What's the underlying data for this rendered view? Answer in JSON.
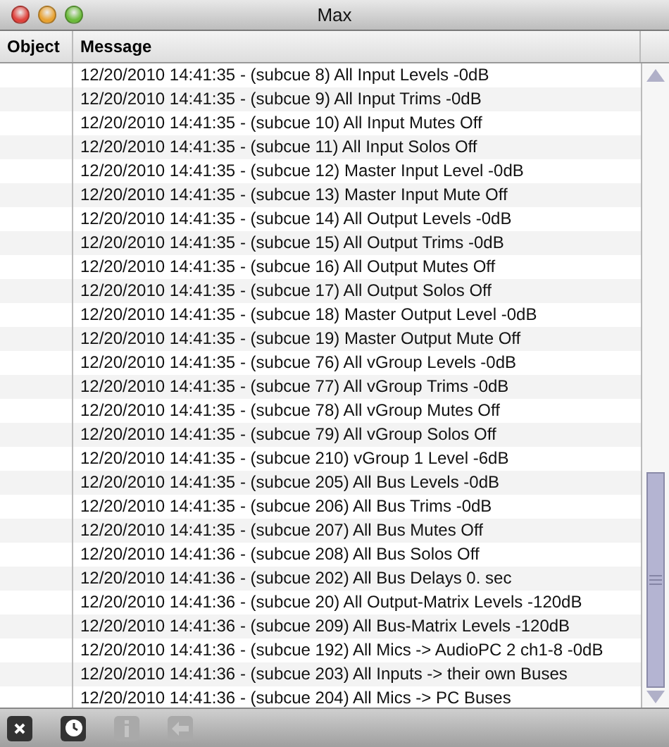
{
  "window": {
    "title": "Max"
  },
  "table": {
    "columns": [
      "Object",
      "Message"
    ],
    "rows": [
      {
        "object": "",
        "message": "12/20/2010 14:41:35 - (subcue 8) All Input Levels -0dB"
      },
      {
        "object": "",
        "message": "12/20/2010 14:41:35 - (subcue 9) All Input Trims -0dB"
      },
      {
        "object": "",
        "message": "12/20/2010 14:41:35 - (subcue 10) All Input Mutes Off"
      },
      {
        "object": "",
        "message": "12/20/2010 14:41:35 - (subcue 11) All Input Solos Off"
      },
      {
        "object": "",
        "message": "12/20/2010 14:41:35 - (subcue 12) Master Input Level -0dB"
      },
      {
        "object": "",
        "message": "12/20/2010 14:41:35 - (subcue 13) Master Input Mute Off"
      },
      {
        "object": "",
        "message": "12/20/2010 14:41:35 - (subcue 14) All Output Levels -0dB"
      },
      {
        "object": "",
        "message": "12/20/2010 14:41:35 - (subcue 15) All Output Trims -0dB"
      },
      {
        "object": "",
        "message": "12/20/2010 14:41:35 - (subcue 16) All Output Mutes Off"
      },
      {
        "object": "",
        "message": "12/20/2010 14:41:35 - (subcue 17) All Output Solos Off"
      },
      {
        "object": "",
        "message": "12/20/2010 14:41:35 - (subcue 18) Master Output Level -0dB"
      },
      {
        "object": "",
        "message": "12/20/2010 14:41:35 - (subcue 19) Master Output Mute Off"
      },
      {
        "object": "",
        "message": "12/20/2010 14:41:35 - (subcue 76) All vGroup Levels -0dB"
      },
      {
        "object": "",
        "message": "12/20/2010 14:41:35 - (subcue 77) All vGroup Trims -0dB"
      },
      {
        "object": "",
        "message": "12/20/2010 14:41:35 - (subcue 78) All vGroup Mutes Off"
      },
      {
        "object": "",
        "message": "12/20/2010 14:41:35 - (subcue 79) All vGroup Solos Off"
      },
      {
        "object": "",
        "message": "12/20/2010 14:41:35 - (subcue 210) vGroup 1 Level -6dB"
      },
      {
        "object": "",
        "message": "12/20/2010 14:41:35 - (subcue 205) All Bus Levels -0dB"
      },
      {
        "object": "",
        "message": "12/20/2010 14:41:35 - (subcue 206) All Bus Trims -0dB"
      },
      {
        "object": "",
        "message": "12/20/2010 14:41:35 - (subcue 207) All Bus Mutes Off"
      },
      {
        "object": "",
        "message": "12/20/2010 14:41:36 - (subcue 208) All Bus Solos Off"
      },
      {
        "object": "",
        "message": "12/20/2010 14:41:36 - (subcue 202) All Bus Delays 0. sec"
      },
      {
        "object": "",
        "message": "12/20/2010 14:41:36 - (subcue 20) All Output-Matrix Levels -120dB"
      },
      {
        "object": "",
        "message": "12/20/2010 14:41:36 - (subcue 209) All Bus-Matrix Levels -120dB"
      },
      {
        "object": "",
        "message": "12/20/2010 14:41:36 - (subcue 192) All Mics -> AudioPC 2 ch1-8 -0dB"
      },
      {
        "object": "",
        "message": "12/20/2010 14:41:36 - (subcue 203) All Inputs -> their own Buses"
      },
      {
        "object": "",
        "message": "12/20/2010 14:41:36 - (subcue 204) All Mics -> PC Buses"
      }
    ]
  },
  "toolbar": [
    {
      "kind": "clear",
      "disabled": false
    },
    {
      "kind": "timestamp",
      "disabled": false
    },
    {
      "kind": "info",
      "disabled": true
    },
    {
      "kind": "back",
      "disabled": true
    }
  ]
}
